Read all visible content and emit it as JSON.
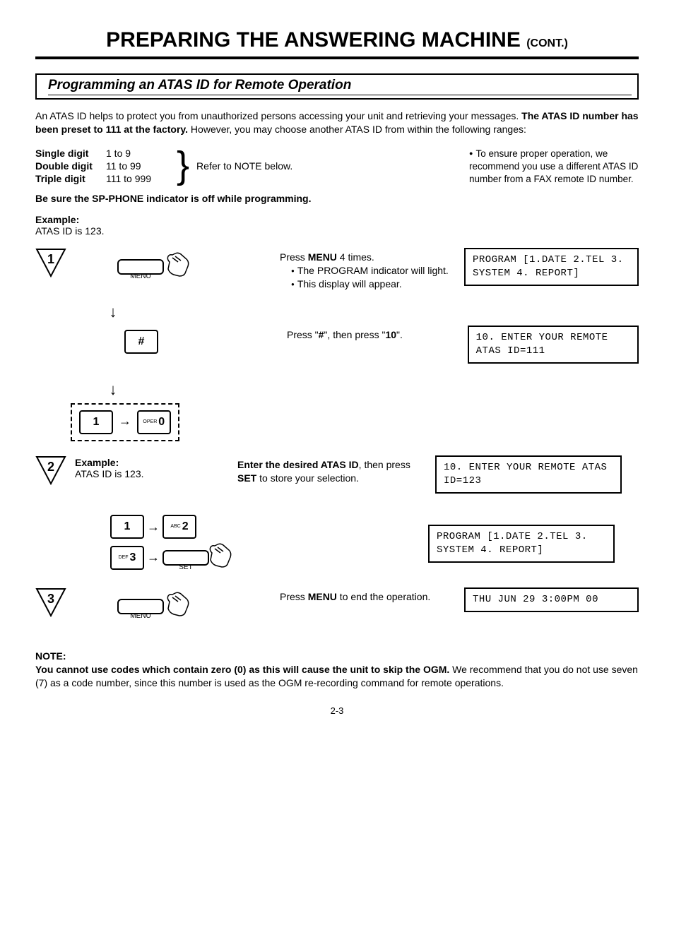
{
  "title_main": "PREPARING THE ANSWERING MACHINE",
  "title_cont": "(CONT.)",
  "section_header": "Programming an ATAS ID for Remote Operation",
  "intro_a": "An ATAS ID helps to protect you from unauthorized persons accessing your unit and retrieving your messages. ",
  "intro_b": "The ATAS ID number has been preset to 111 at the factory.",
  "intro_c": " However, you may choose another ATAS ID from within the following ranges:",
  "ranges": {
    "single_lbl": "Single digit",
    "single_val": "1 to 9",
    "double_lbl": "Double digit",
    "double_val": "11 to 99",
    "triple_lbl": "Triple digit",
    "triple_val": "111 to 999"
  },
  "refer": "Refer to NOTE below.",
  "ensure": "To ensure proper operation, we recommend you use a different ATAS ID number from a FAX remote ID number.",
  "warn": "Be sure the SP-PHONE indicator is off while programming.",
  "example_hdr": "Example:",
  "example_val": "ATAS ID is 123.",
  "steps": {
    "s1": {
      "num": "1",
      "text_a": "Press ",
      "text_b": "MENU",
      "text_c": " 4 times.",
      "sub1": "The PROGRAM indicator will light.",
      "sub2": "This display will appear.",
      "display": "PROGRAM [1.DATE 2.TEL 3. SYSTEM 4. REPORT]",
      "menu_lbl": "MENU"
    },
    "s1b": {
      "text_a": "Press \"",
      "text_b": "#",
      "text_c": "\", then press \"",
      "text_d": "10",
      "text_e": "\".",
      "display": "10. ENTER YOUR REMOTE ATAS ID=111",
      "key_hash": "#",
      "key_1": "1",
      "key_0_tiny": "OPER",
      "key_0": "0"
    },
    "s2": {
      "num": "2",
      "ex_hdr": "Example:",
      "ex_val": "ATAS ID is 123.",
      "text_a": "Enter the desired ATAS ID",
      "text_b": ", then press ",
      "text_c": "SET",
      "text_d": " to store your selection.",
      "display1": "10. ENTER YOUR REMOTE ATAS ID=123",
      "display2": "PROGRAM [1.DATE 2.TEL 3. SYSTEM 4. REPORT]",
      "key_1": "1",
      "key_2_tiny": "ABC",
      "key_2": "2",
      "key_3_tiny": "DEF",
      "key_3": "3",
      "set_lbl": "SET"
    },
    "s3": {
      "num": "3",
      "text_a": "Press ",
      "text_b": "MENU",
      "text_c": " to end the operation.",
      "display": "THU JUN 29  3:00PM 00",
      "menu_lbl": "MENU"
    }
  },
  "note": {
    "hdr": "NOTE:",
    "bold": "You cannot use codes which contain zero (0) as this will cause the unit to skip the OGM.",
    "rest": " We recommend that you do not use seven (7) as a code number, since this number is used as the OGM re-recording command for remote operations."
  },
  "page_num": "2-3"
}
